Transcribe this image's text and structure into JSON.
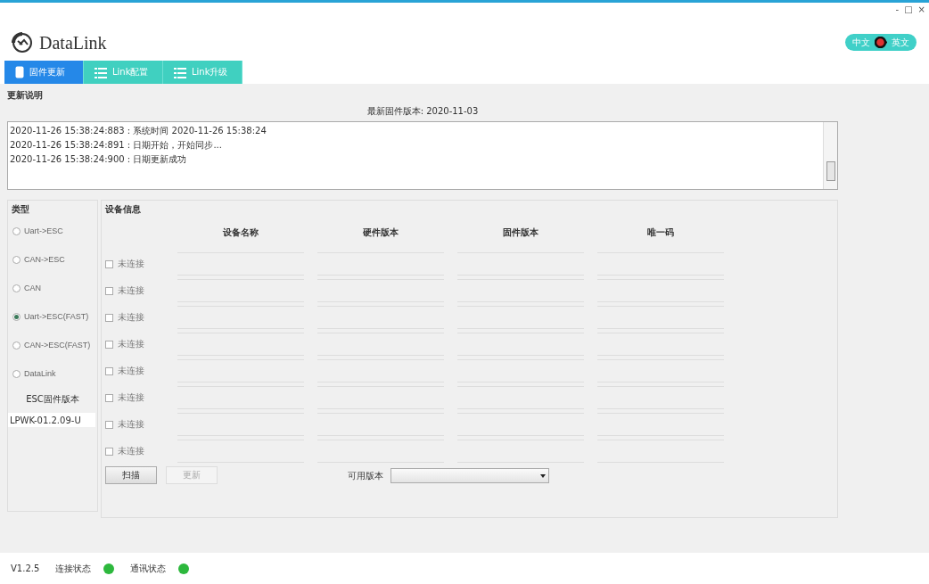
{
  "window": {
    "controls": [
      "-",
      "□",
      "×"
    ]
  },
  "app": {
    "name": "DataLink"
  },
  "language_toggle": {
    "left": "中文",
    "right": "英文"
  },
  "tabs": [
    {
      "label": "固件更新",
      "selected": true
    },
    {
      "label": "Link配置",
      "selected": false
    },
    {
      "label": "Link升级",
      "selected": false
    }
  ],
  "section_title": "更新说明",
  "latest_version": "最新固件版本: 2020-11-03",
  "log": [
    "2020-11-26 15:38:24:883 : 系统时间 2020-11-26 15:38:24",
    "2020-11-26 15:38:24:891 : 日期开始，开始同步...",
    "2020-11-26 15:38:24:900 : 日期更新成功"
  ],
  "type_group": {
    "title": "类型",
    "options": [
      {
        "label": "Uart->ESC",
        "selected": false
      },
      {
        "label": "CAN->ESC",
        "selected": false
      },
      {
        "label": "CAN",
        "selected": false
      },
      {
        "label": "Uart->ESC(FAST)",
        "selected": true
      },
      {
        "label": "CAN->ESC(FAST)",
        "selected": false
      },
      {
        "label": "DataLink",
        "selected": false
      }
    ]
  },
  "esc_version": {
    "label": "ESC固件版本",
    "value": "LPWK-01.2.09-U"
  },
  "device_group": {
    "title": "设备信息",
    "columns": [
      "设备名称",
      "硬件版本",
      "固件版本",
      "唯一码"
    ],
    "rows": [
      {
        "label": "未连接",
        "checked": false
      },
      {
        "label": "未连接",
        "checked": false
      },
      {
        "label": "未连接",
        "checked": false
      },
      {
        "label": "未连接",
        "checked": false
      },
      {
        "label": "未连接",
        "checked": false
      },
      {
        "label": "未连接",
        "checked": false
      },
      {
        "label": "未连接",
        "checked": false
      },
      {
        "label": "未连接",
        "checked": false
      }
    ]
  },
  "buttons": [
    {
      "label": "扫描",
      "disabled": false
    },
    {
      "label": "更新",
      "disabled": true
    }
  ],
  "available_version": {
    "label": "可用版本"
  },
  "status_bar": {
    "version": "V1.2.5",
    "indicators": [
      {
        "label": "连接状态",
        "color": "#2db83d"
      },
      {
        "label": "通讯状态",
        "color": "#2db83d"
      }
    ]
  }
}
